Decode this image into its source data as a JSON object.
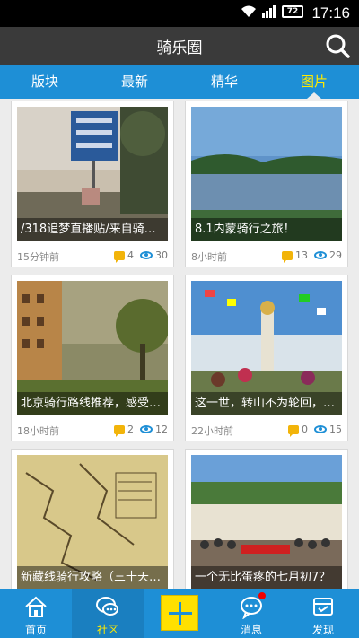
{
  "status": {
    "time": "17:16",
    "battery": "72"
  },
  "header": {
    "title": "骑乐圈"
  },
  "tabs": [
    {
      "label": "版块",
      "active": false
    },
    {
      "label": "最新",
      "active": false
    },
    {
      "label": "精华",
      "active": false
    },
    {
      "label": "图片",
      "active": true
    }
  ],
  "posts": [
    {
      "caption": "/318追梦直播贴/来自骑…",
      "time": "15分钟前",
      "comments": "4",
      "views": "30",
      "image": "road-sign-photo"
    },
    {
      "caption": "8.1内蒙骑行之旅！",
      "time": "8小时前",
      "comments": "13",
      "views": "29",
      "image": "lake-photo"
    },
    {
      "caption": "北京骑行路线推荐，感受…",
      "time": "18小时前",
      "comments": "2",
      "views": "12",
      "image": "building-photo"
    },
    {
      "caption": "这一世，转山不为轮回，…",
      "time": "22小时前",
      "comments": "0",
      "views": "15",
      "image": "prayer-flags-photo"
    },
    {
      "caption": "新藏线骑行攻略（三十天…",
      "time": "",
      "comments": "",
      "views": "",
      "image": "map-photo"
    },
    {
      "caption": "一个无比蛋疼的七月初7？",
      "time": "",
      "comments": "",
      "views": "",
      "image": "group-photo"
    }
  ],
  "nav": [
    {
      "label": "首页",
      "icon": "home-icon"
    },
    {
      "label": "社区",
      "icon": "chat-icon"
    },
    {
      "label": "",
      "icon": "plus-icon"
    },
    {
      "label": "消息",
      "icon": "message-icon"
    },
    {
      "label": "发现",
      "icon": "discover-icon"
    }
  ],
  "colors": {
    "primary": "#1e8fd6",
    "active_tab": "#ffea00",
    "titlebar": "#3a3a3a",
    "plus": "#ffe000"
  }
}
